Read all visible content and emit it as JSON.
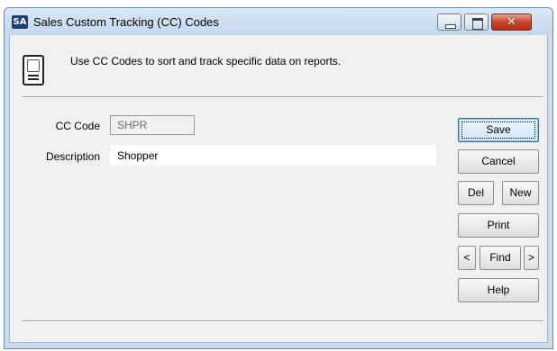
{
  "window": {
    "app_badge": "SA",
    "title": "Sales Custom Tracking (CC) Codes",
    "controls": {
      "close_glyph": "✕"
    }
  },
  "header": {
    "icon": "document-gear-icon",
    "info_text": "Use CC Codes to sort and track specific data on reports."
  },
  "form": {
    "cc_code_label": "CC Code",
    "cc_code_value": "SHPR",
    "description_label": "Description",
    "description_value": "Shopper"
  },
  "buttons": {
    "save": "Save",
    "cancel": "Cancel",
    "del": "Del",
    "new": "New",
    "print": "Print",
    "prev": "<",
    "find": "Find",
    "next": ">",
    "help": "Help"
  },
  "colors": {
    "chrome": "#c9dcee",
    "client": "#f0f0f0",
    "close_button": "#c7452b",
    "focus_border": "#2f6fb0"
  }
}
